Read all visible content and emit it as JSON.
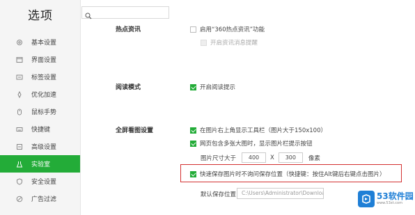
{
  "sidebar": {
    "title": "选项",
    "items": [
      {
        "label": "基本设置",
        "icon": "settings-icon"
      },
      {
        "label": "界面设置",
        "icon": "window-icon"
      },
      {
        "label": "标签设置",
        "icon": "tag-icon"
      },
      {
        "label": "优化加速",
        "icon": "rocket-icon"
      },
      {
        "label": "鼠标手势",
        "icon": "mouse-icon"
      },
      {
        "label": "快捷键",
        "icon": "keyboard-icon"
      },
      {
        "label": "高级设置",
        "icon": "advanced-icon"
      },
      {
        "label": "实验室",
        "icon": "lab-icon",
        "active": true
      },
      {
        "label": "安全设置",
        "icon": "shield-icon"
      },
      {
        "label": "广告过滤",
        "icon": "filter-icon"
      }
    ]
  },
  "search": {
    "placeholder": "",
    "value": ""
  },
  "sections": {
    "hot": {
      "label": "热点资讯",
      "opt1": "启用“360热点资讯”功能",
      "opt2": "开启资讯消息提醒"
    },
    "reading": {
      "label": "阅读模式",
      "opt1": "开启阅读提示"
    },
    "fullscreen": {
      "label": "全屏看图设置",
      "opt1": "在图片右上角显示工具栏（图片大于150x100）",
      "opt2": "网页包含多张大图时，显示图片栏提示按钮",
      "size_prefix": "图片尺寸大于",
      "width": "400",
      "times": "X",
      "height": "300",
      "unit": "像素",
      "opt3": "快速保存图片时不询问保存位置（快捷键：按住Alt键后右键点击图片）",
      "save_label": "默认保存位置：",
      "save_path": "C:\\Users\\Administrator\\Downloads"
    }
  },
  "watermark": {
    "brand": "53软件园",
    "site": "www.53xt.com"
  },
  "colors": {
    "accent": "#23ac38",
    "highlight": "#d32f2f"
  }
}
